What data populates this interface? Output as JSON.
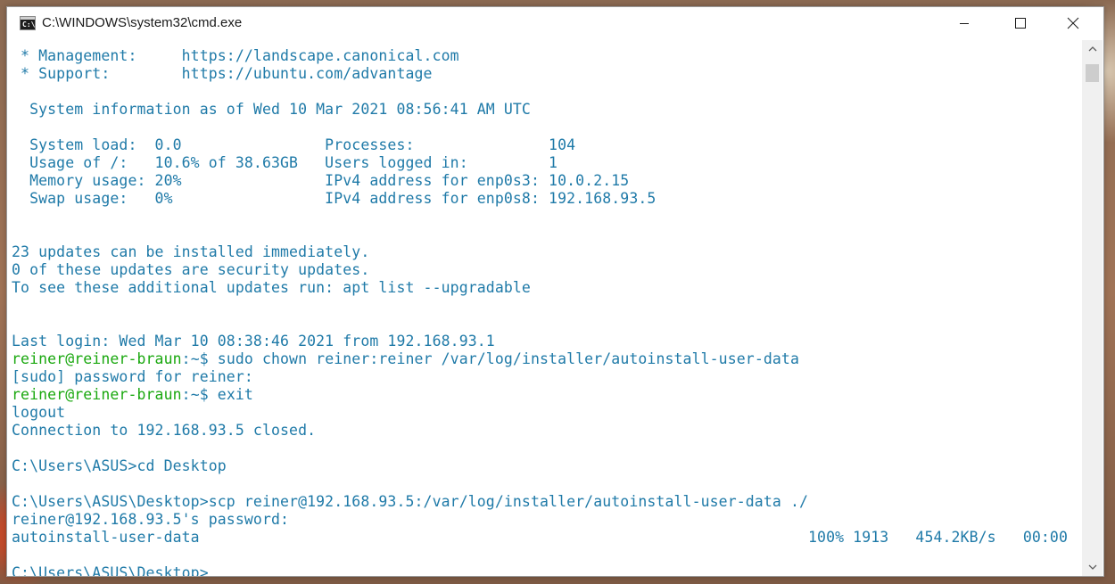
{
  "window": {
    "title": "C:\\WINDOWS\\system32\\cmd.exe",
    "icon": "cmd-icon",
    "controls": {
      "minimize": "minimize-icon",
      "maximize": "maximize-icon",
      "close": "close-icon"
    }
  },
  "colors": {
    "text_primary": "#1f7aa8",
    "prompt_user": "#1aa80f",
    "background": "#ffffff"
  },
  "console": {
    "lines": {
      "l01": " * Management:     https://landscape.canonical.com",
      "l02": " * Support:        https://ubuntu.com/advantage",
      "l03": "  System information as of Wed 10 Mar 2021 08:56:41 AM UTC",
      "l04": "  System load:  0.0                Processes:               104",
      "l05": "  Usage of /:   10.6% of 38.63GB   Users logged in:         1",
      "l06": "  Memory usage: 20%                IPv4 address for enp0s3: 10.0.2.15",
      "l07": "  Swap usage:   0%                 IPv4 address for enp0s8: 192.168.93.5",
      "l08": "23 updates can be installed immediately.",
      "l09": "0 of these updates are security updates.",
      "l10": "To see these additional updates run: apt list --upgradable",
      "l11": "Last login: Wed Mar 10 08:38:46 2021 from 192.168.93.1",
      "l12_user": "reiner@reiner-braun",
      "l12_cmd": ":~$ sudo chown reiner:reiner /var/log/installer/autoinstall-user-data",
      "l13": "[sudo] password for reiner:",
      "l14_user": "reiner@reiner-braun",
      "l14_cmd": ":~$ exit",
      "l15": "logout",
      "l16": "Connection to 192.168.93.5 closed.",
      "l17": "C:\\Users\\ASUS>cd Desktop",
      "l18": "C:\\Users\\ASUS\\Desktop>scp reiner@192.168.93.5:/var/log/installer/autoinstall-user-data ./",
      "l19": "reiner@192.168.93.5's password:",
      "l20": "autoinstall-user-data                                                                    100% 1913   454.2KB/s   00:00",
      "l21": "C:\\Users\\ASUS\\Desktop>"
    }
  }
}
